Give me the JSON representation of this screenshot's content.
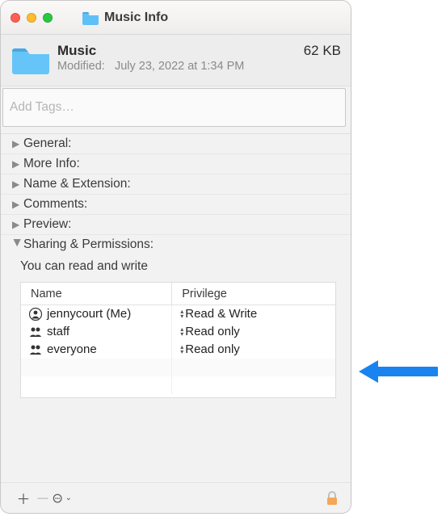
{
  "window": {
    "title": "Music Info"
  },
  "header": {
    "name": "Music",
    "modified_label": "Modified:",
    "modified_value": "July 23, 2022 at 1:34 PM",
    "size": "62 KB"
  },
  "tags": {
    "placeholder": "Add Tags…"
  },
  "sections": {
    "general": "General:",
    "more_info": "More Info:",
    "name_ext": "Name & Extension:",
    "comments": "Comments:",
    "preview": "Preview:",
    "sharing": "Sharing & Permissions:"
  },
  "permissions": {
    "message": "You can read and write",
    "columns": {
      "name": "Name",
      "privilege": "Privilege"
    },
    "rows": [
      {
        "icon": "person",
        "name": "jennycourt (Me)",
        "privilege": "Read & Write"
      },
      {
        "icon": "group",
        "name": "staff",
        "privilege": "Read only"
      },
      {
        "icon": "group",
        "name": "everyone",
        "privilege": "Read only"
      }
    ]
  }
}
